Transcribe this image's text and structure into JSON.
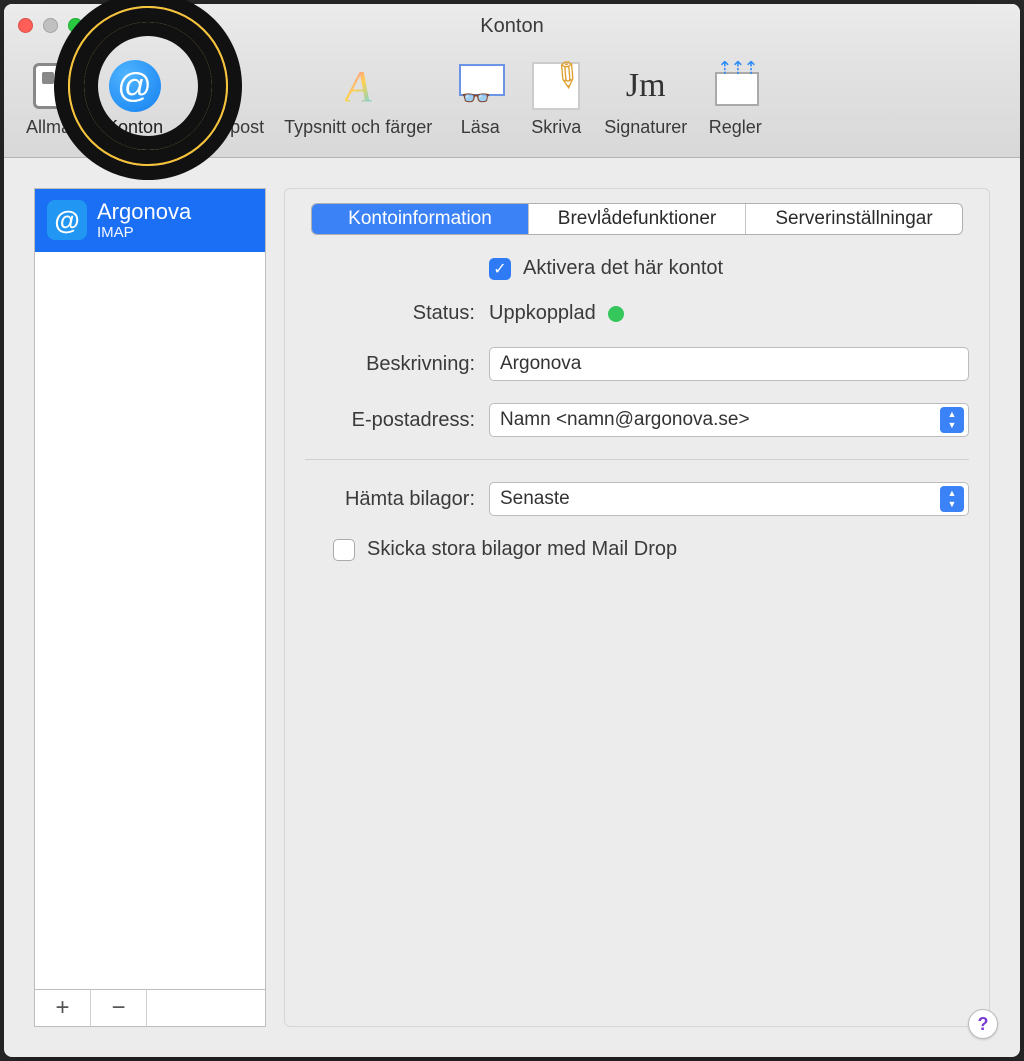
{
  "window": {
    "title": "Konton"
  },
  "toolbar": {
    "items": [
      {
        "label": "Allmänt"
      },
      {
        "label": "Konton"
      },
      {
        "label": "Skräppost"
      },
      {
        "label": "Typsnitt och färger"
      },
      {
        "label": "Läsa"
      },
      {
        "label": "Skriva"
      },
      {
        "label": "Signaturer"
      },
      {
        "label": "Regler"
      }
    ],
    "selected": "Konton"
  },
  "sidebar": {
    "accounts": [
      {
        "name": "Argonova",
        "subtitle": "IMAP"
      }
    ]
  },
  "tabs": {
    "items": [
      "Kontoinformation",
      "Brevlådefunktioner",
      "Serverinställningar"
    ],
    "active": "Kontoinformation"
  },
  "form": {
    "enable_label": "Aktivera det här kontot",
    "enable_checked": true,
    "status_label": "Status:",
    "status_value": "Uppkopplad",
    "status_color": "#35c75b",
    "description_label": "Beskrivning:",
    "description_value": "Argonova",
    "email_label": "E-postadress:",
    "email_value": "Namn <namn@argonova.se>",
    "attachments_label": "Hämta bilagor:",
    "attachments_value": "Senaste",
    "maildrop_label": "Skicka stora bilagor med Mail Drop",
    "maildrop_checked": false
  },
  "footer": {
    "add": "+",
    "remove": "−",
    "help": "?"
  }
}
